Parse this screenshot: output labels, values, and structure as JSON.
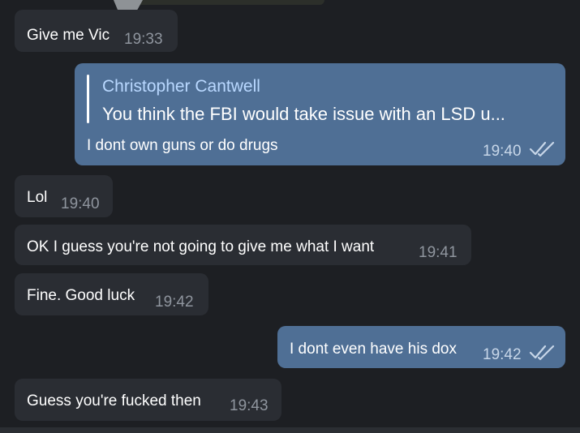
{
  "messages": [
    {
      "text": "Give me Vic",
      "time": "19:33"
    },
    {
      "reply_author": "Christopher Cantwell",
      "reply_text": "You think the FBI would take issue with an LSD u...",
      "text": "I dont own guns or do drugs",
      "time": "19:40"
    },
    {
      "text": "Lol",
      "time": "19:40"
    },
    {
      "text": "OK I guess you're not going to give me what I want",
      "time": "19:41"
    },
    {
      "text": "Fine. Good luck",
      "time": "19:42"
    },
    {
      "text": "I dont even have his dox",
      "time": "19:42"
    },
    {
      "text": "Guess you're fucked then",
      "time": "19:43"
    }
  ],
  "icons": {
    "read_receipt": "double-check-icon"
  },
  "colors": {
    "background": "#1d1f23",
    "incoming_bubble": "#2a2d33",
    "outgoing_bubble": "#4f6f95",
    "reply_author": "#b9d8ff"
  }
}
